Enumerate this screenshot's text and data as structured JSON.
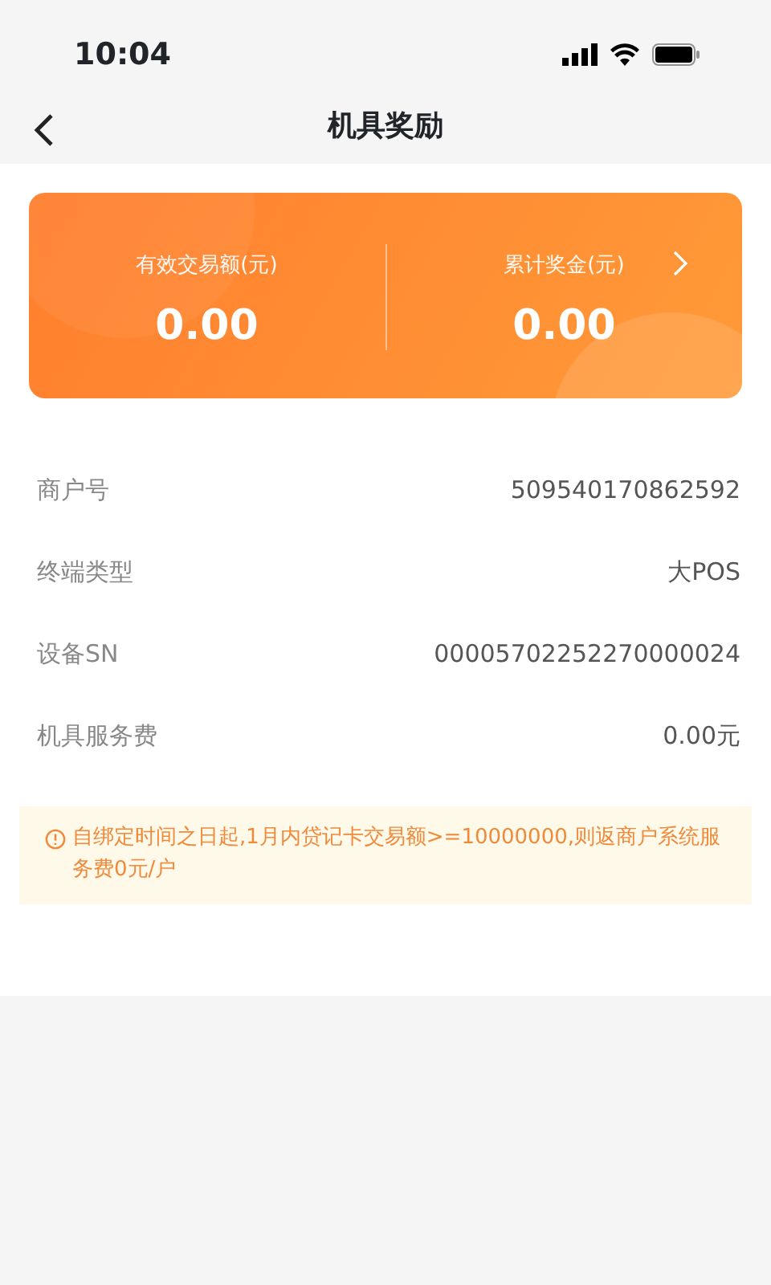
{
  "status_bar": {
    "time": "10:04"
  },
  "header": {
    "title": "机具奖励"
  },
  "summary": [
    {
      "label": "有效交易额(元)",
      "value": "0.00",
      "kind": "plain"
    },
    {
      "label": "累计奖金(元)",
      "value": "0.00",
      "kind": "link"
    }
  ],
  "details": [
    {
      "label": "商户号",
      "value": "509540170862592"
    },
    {
      "label": "终端类型",
      "value": "大POS"
    },
    {
      "label": "设备SN",
      "value": "00005702252270000024"
    },
    {
      "label": "机具服务费",
      "value": "0.00元"
    }
  ],
  "notice": {
    "text": "自绑定时间之日起,1月内贷记卡交易额>=10000000,则返商户系统服务费0元/户"
  }
}
